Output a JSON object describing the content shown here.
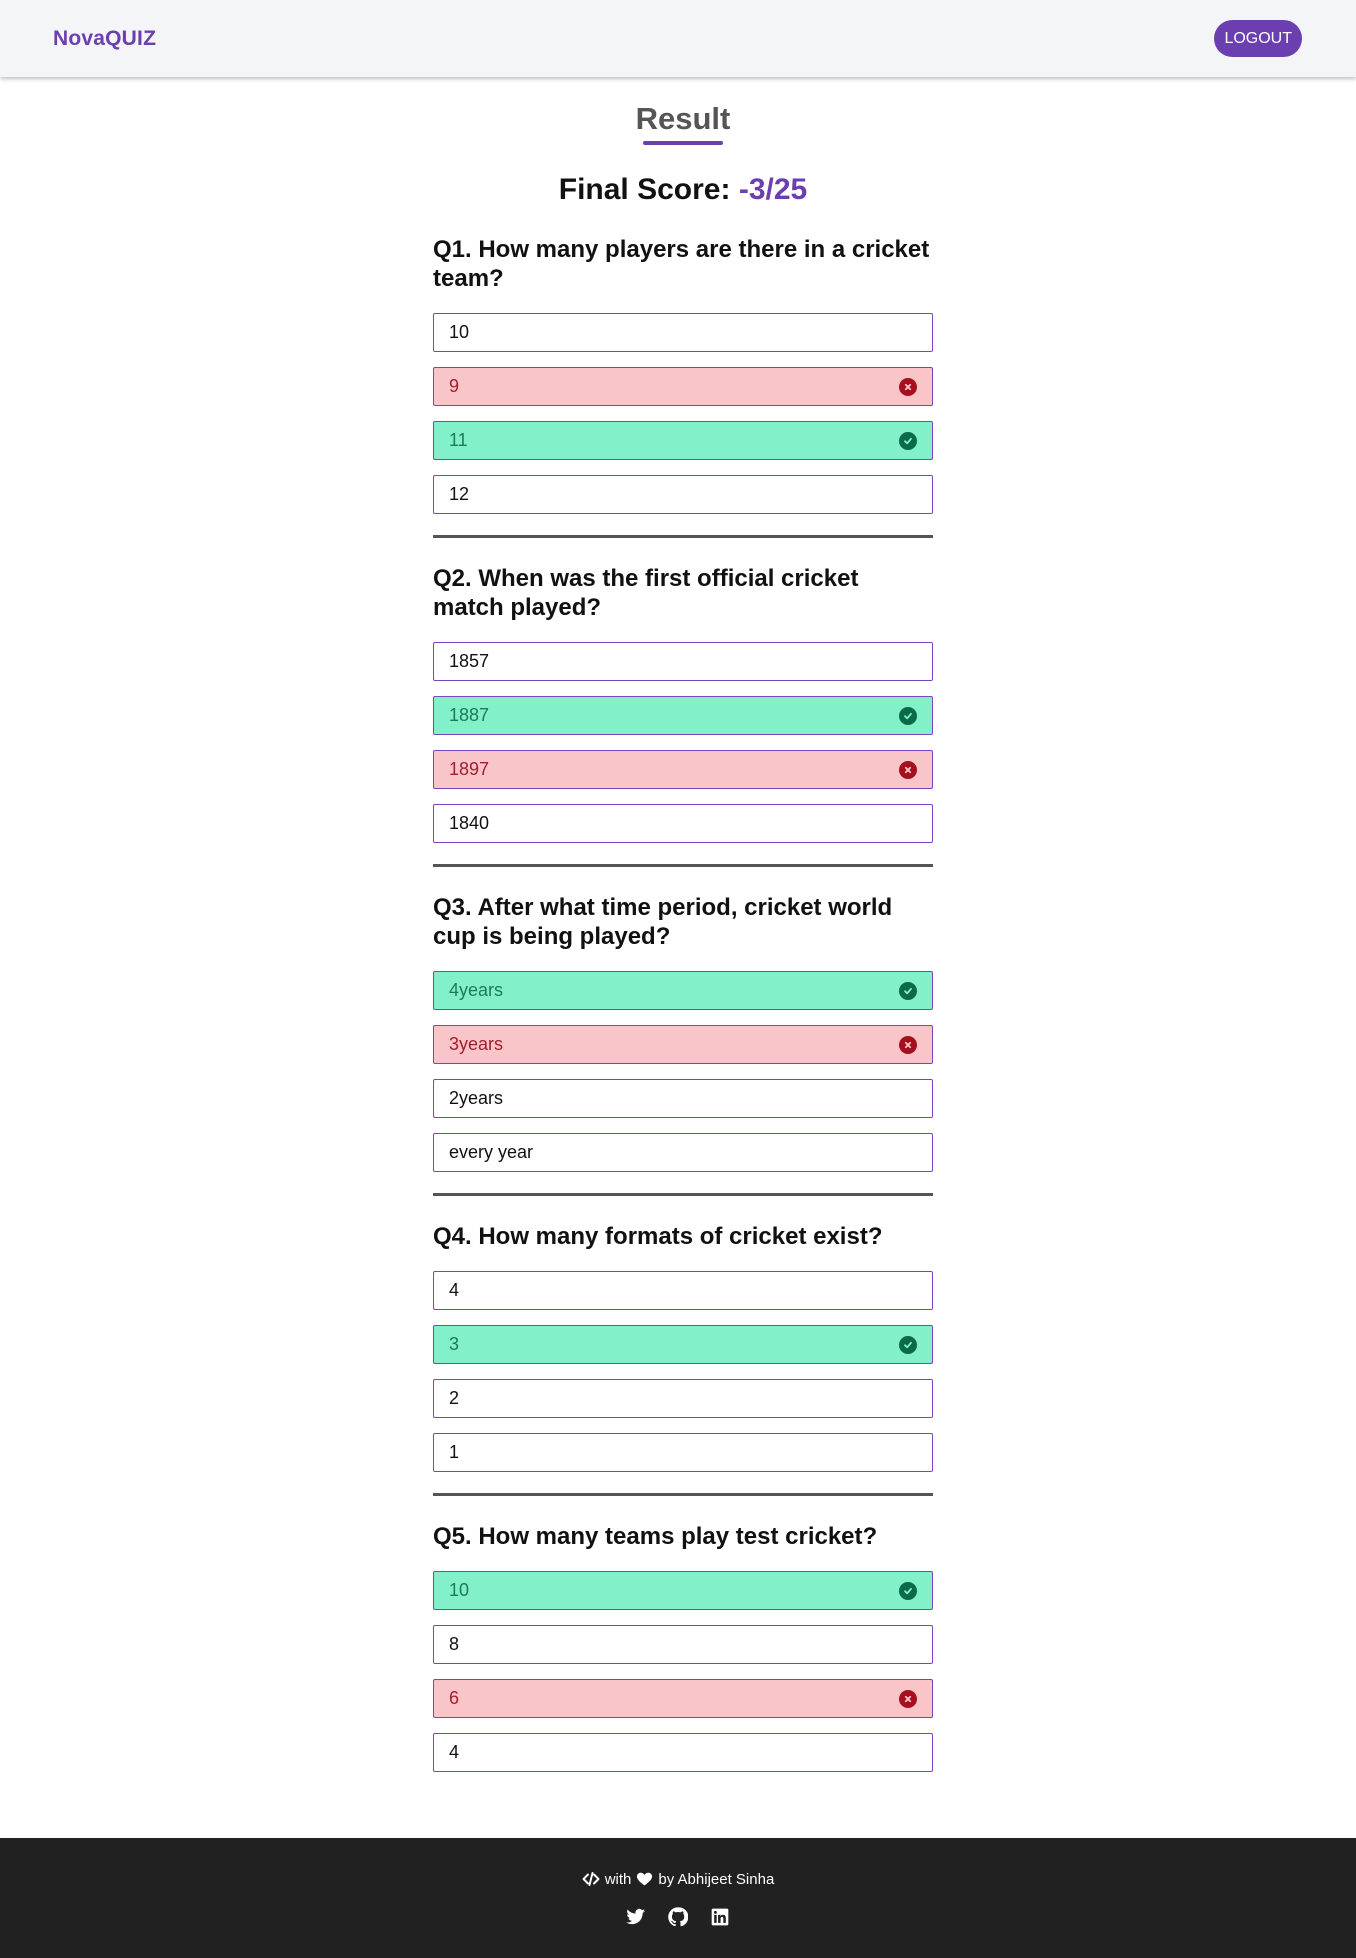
{
  "header": {
    "brand": "NovaQUIZ",
    "logout_label": "LOGOUT"
  },
  "page": {
    "title": "Result",
    "score_label": "Final Score:",
    "score_value": "-3/25"
  },
  "questions": [
    {
      "text": "Q1. How many players are there in a cricket team?",
      "options": [
        {
          "label": "10",
          "state": "neutral"
        },
        {
          "label": "9",
          "state": "wrong"
        },
        {
          "label": "11",
          "state": "correct"
        },
        {
          "label": "12",
          "state": "neutral"
        }
      ]
    },
    {
      "text": "Q2. When was the first official cricket match played?",
      "options": [
        {
          "label": "1857",
          "state": "neutral"
        },
        {
          "label": "1887",
          "state": "correct"
        },
        {
          "label": "1897",
          "state": "wrong"
        },
        {
          "label": "1840",
          "state": "neutral"
        }
      ]
    },
    {
      "text": "Q3. After what time period, cricket world cup is being played?",
      "options": [
        {
          "label": "4years",
          "state": "correct"
        },
        {
          "label": "3years",
          "state": "wrong"
        },
        {
          "label": "2years",
          "state": "neutral"
        },
        {
          "label": "every year",
          "state": "neutral"
        }
      ]
    },
    {
      "text": "Q4. How many formats of cricket exist?",
      "options": [
        {
          "label": "4",
          "state": "neutral"
        },
        {
          "label": "3",
          "state": "correct"
        },
        {
          "label": "2",
          "state": "neutral"
        },
        {
          "label": "1",
          "state": "neutral"
        }
      ]
    },
    {
      "text": "Q5. How many teams play test cricket?",
      "options": [
        {
          "label": "10",
          "state": "correct"
        },
        {
          "label": "8",
          "state": "neutral"
        },
        {
          "label": "6",
          "state": "wrong"
        },
        {
          "label": "4",
          "state": "neutral"
        }
      ]
    }
  ],
  "footer": {
    "with_text": "with",
    "by_text": "by Abhijeet Sinha",
    "icons": [
      "code-icon",
      "heart-icon",
      "twitter-icon",
      "github-icon",
      "linkedin-icon"
    ]
  },
  "colors": {
    "accent": "#6b3fb0",
    "correct_bg": "#82f0c8",
    "wrong_bg": "#f9c5c8",
    "footer_bg": "#212121"
  }
}
